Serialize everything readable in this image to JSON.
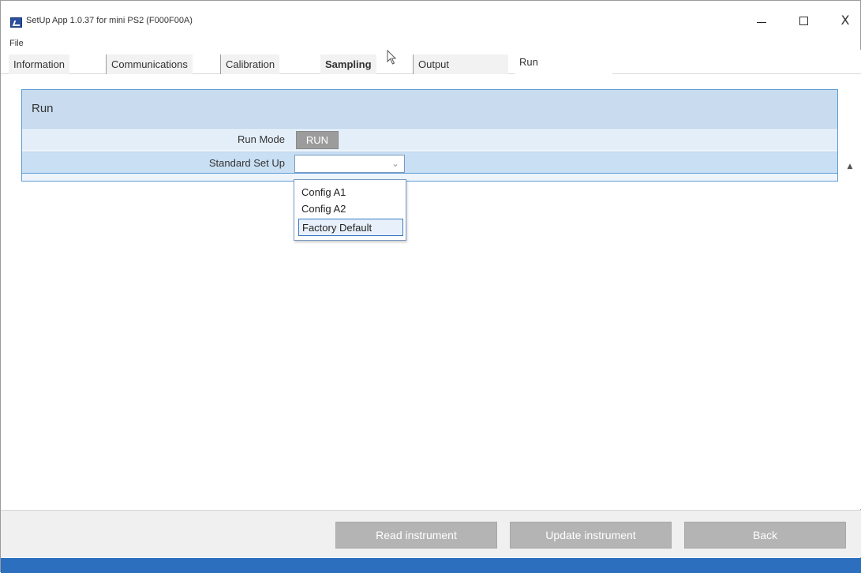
{
  "window": {
    "title": "SetUp App 1.0.37 for mini PS2 (F000F00A)",
    "min_glyph": "",
    "max_glyph": "",
    "close_glyph": "X"
  },
  "menu": {
    "file": "File"
  },
  "tabs": [
    {
      "label": "Information"
    },
    {
      "label": "Communications"
    },
    {
      "label": "Calibration"
    },
    {
      "label": "Sampling"
    },
    {
      "label": "Output"
    },
    {
      "label": "Run"
    }
  ],
  "panel": {
    "header": "Run",
    "rows": [
      {
        "label": "Run Mode",
        "button": "RUN"
      },
      {
        "label": "Standard Set Up",
        "selected_value": ""
      }
    ],
    "dropdown_options": [
      "Config A1",
      "Config A2",
      "Factory Default"
    ]
  },
  "footer": {
    "read_label": "Read instrument",
    "update_label": "Update instrument",
    "back_label": "Back"
  },
  "colors": {
    "accent": "#2c6fbf",
    "panel_header": "#c9dcef",
    "button_grey": "#b4b4b4"
  }
}
